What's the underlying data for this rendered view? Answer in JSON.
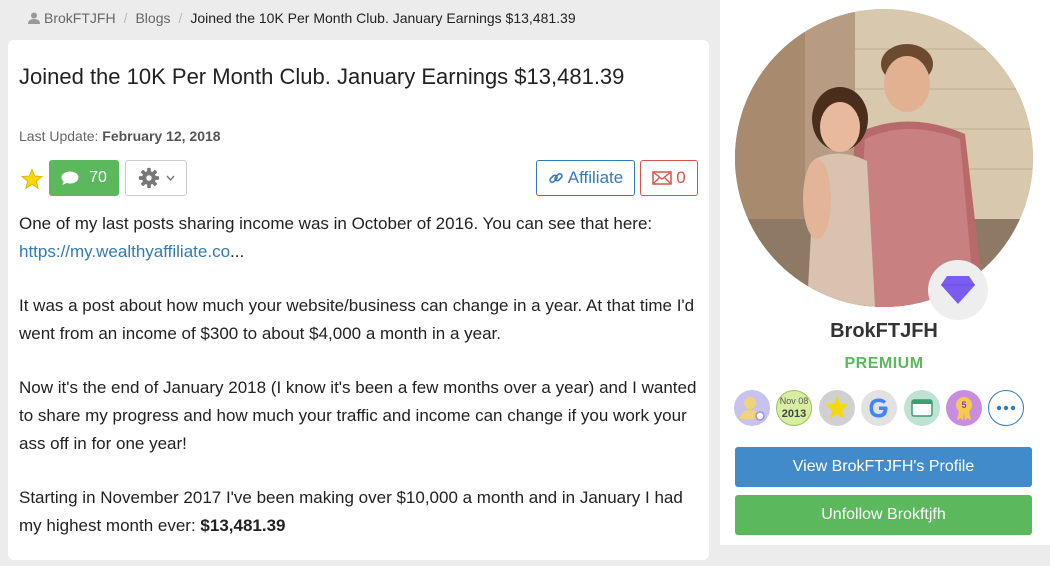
{
  "breadcrumb": {
    "user": "BrokFTJFH",
    "section": "Blogs",
    "current": "Joined the 10K Per Month Club. January Earnings $13,481.39"
  },
  "post": {
    "title": "Joined the 10K Per Month Club. January Earnings $13,481.39",
    "last_update_label": "Last Update:",
    "last_update_date": "February 12, 2018",
    "comment_count": "70",
    "affiliate_label": "Affiliate",
    "mail_count": "0",
    "paragraphs": [
      {
        "text": "One of my last posts sharing income was in October of 2016. You can see that here: ",
        "link": "https://my.wealthyaffiliate.co",
        "suffix": "..."
      },
      {
        "text": "It was a post about how much your website/business can change in a year. At that time I'd went from an income of $300 to about $4,000 a month in a year."
      },
      {
        "text": "Now it's the end of January 2018 (I know it's been a few months over a year) and I wanted to share my progress and how much your traffic and income can change if you work your ass off in for one year!"
      },
      {
        "text": "Starting in November 2017 I've been making over $10,000 a month and in January I had my highest month ever: ",
        "bold": "$13,481.39"
      }
    ]
  },
  "profile": {
    "username": "BrokFTJFH",
    "membership": "PREMIUM",
    "badge_date_month": "Nov 08",
    "badge_date_year": "2013",
    "badge_rank_number": "5",
    "view_profile_label": "View BrokFTJFH's Profile",
    "unfollow_label": "Unfollow Brokftjfh"
  },
  "colors": {
    "accent_blue": "#337ab7",
    "button_blue": "#428bca",
    "green": "#5cb85c",
    "red": "#d9534f"
  }
}
